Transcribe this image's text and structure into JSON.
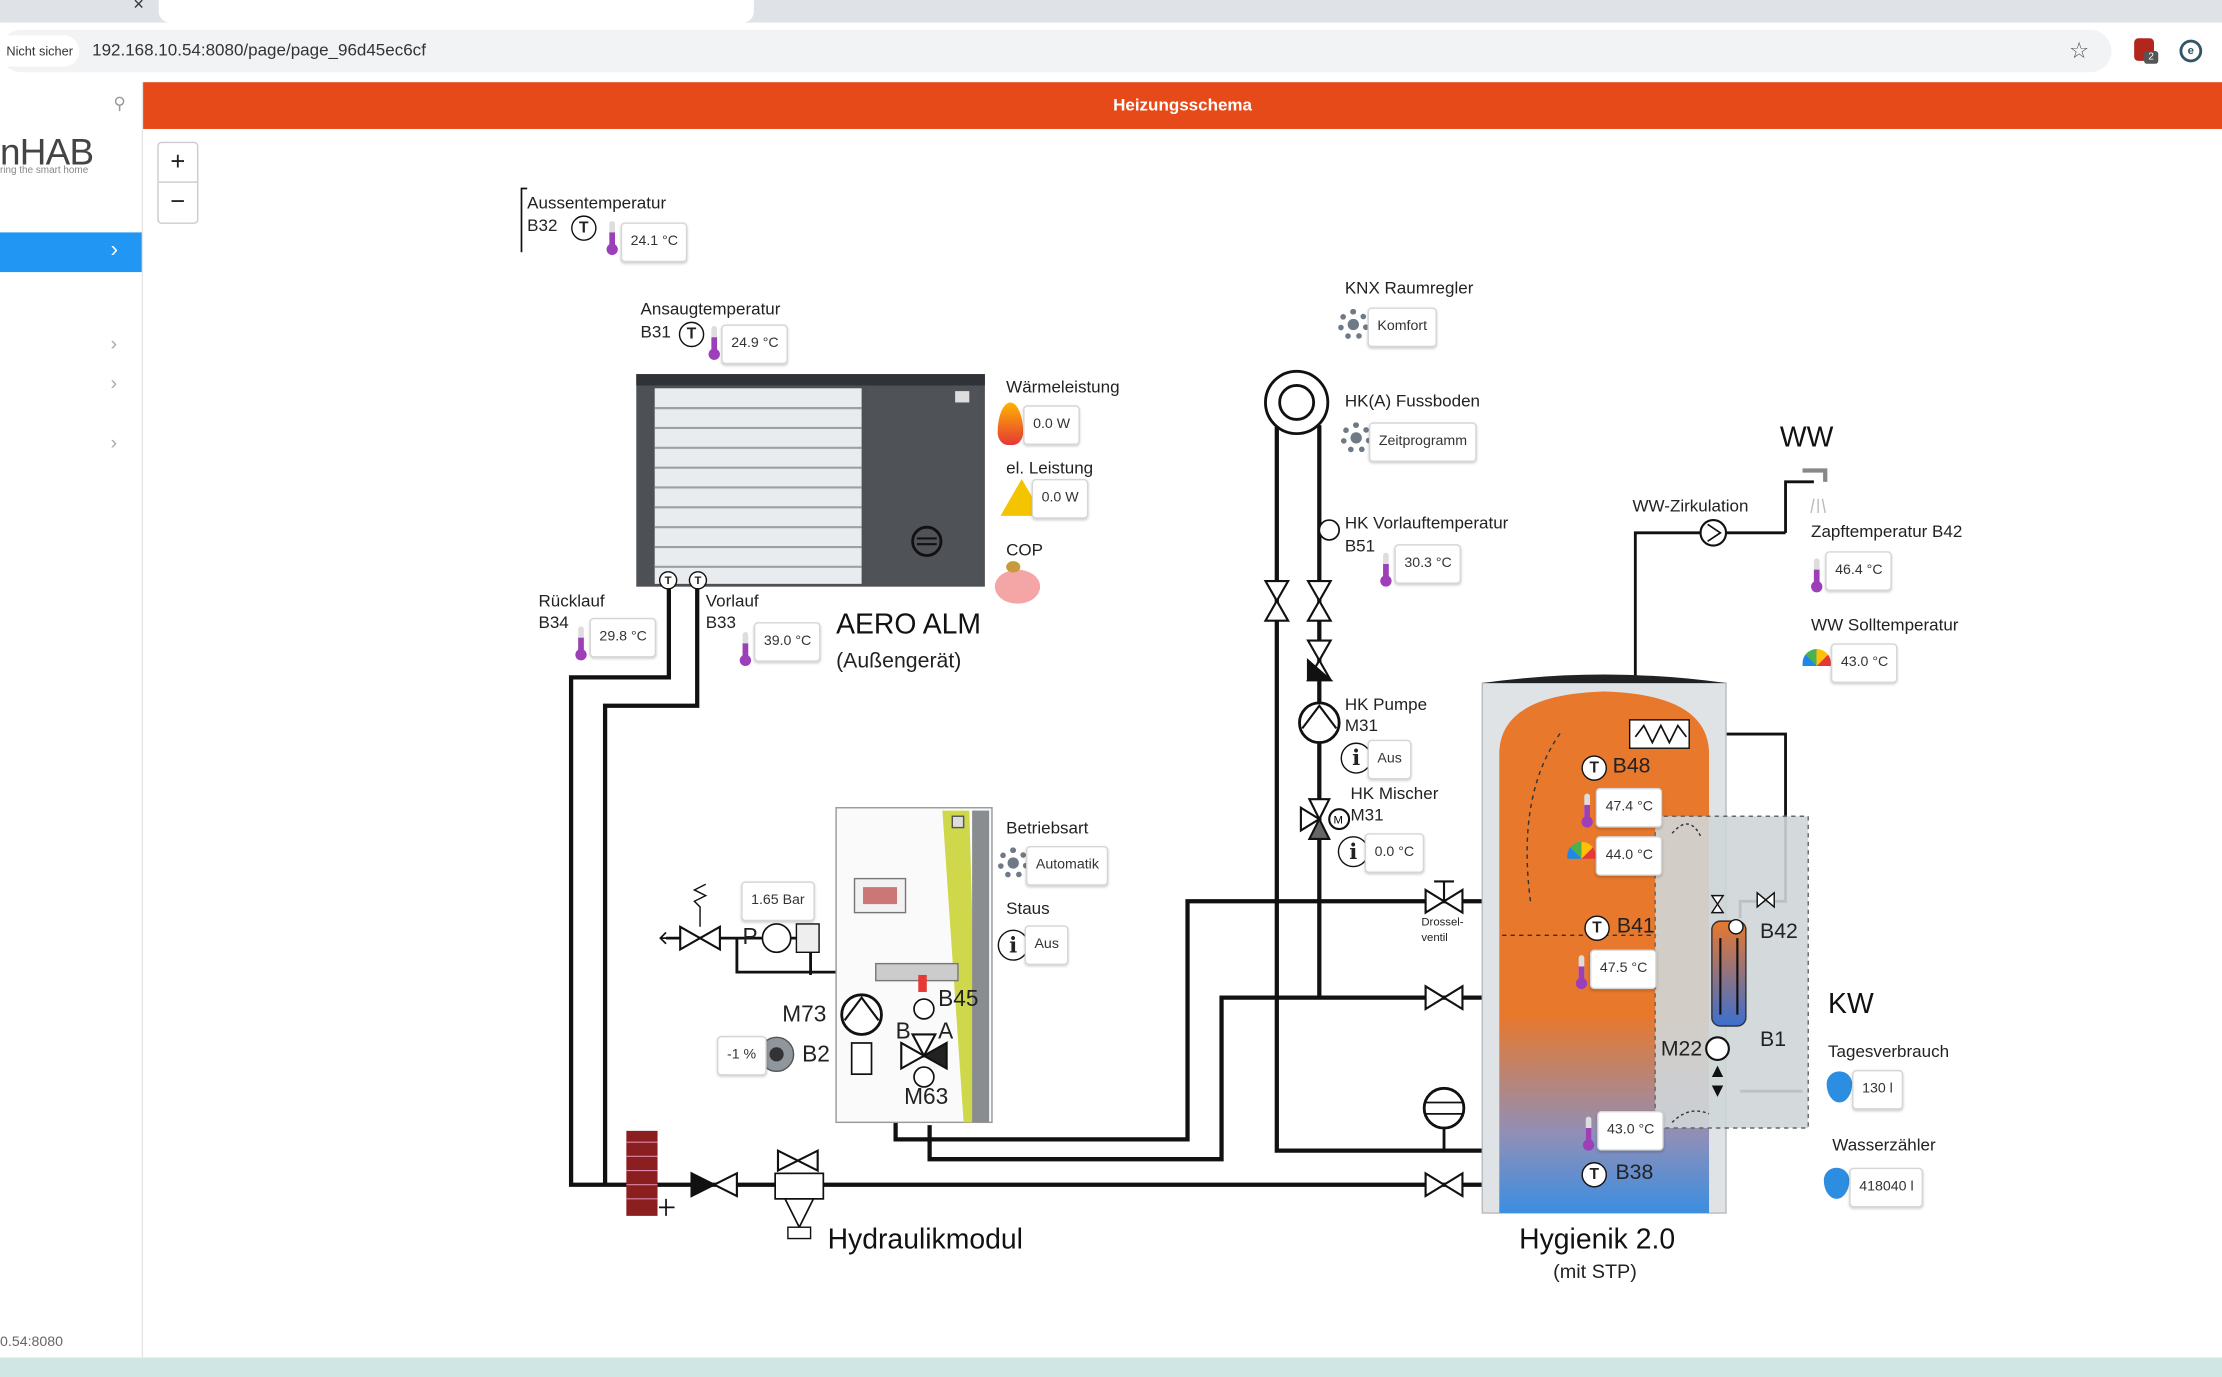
{
  "browser": {
    "security": "Nicht sicher",
    "url": "192.168.10.54:8080/page/page_96d45ec6cf",
    "status_url": "0.54:8080"
  },
  "sidebar": {
    "logo_main": "nHAB",
    "logo_tagline": "ring the smart home"
  },
  "zoom": {
    "plus": "+",
    "minus": "−"
  },
  "header": {
    "title": "Heizungsschema"
  },
  "sensors": {
    "b32": {
      "label": "Aussentemperatur",
      "code": "B32",
      "value": "24.1 °C"
    },
    "b31": {
      "label": "Ansaugtemperatur",
      "code": "B31",
      "value": "24.9 °C"
    },
    "b34": {
      "label": "Rücklauf",
      "code": "B34",
      "value": "29.8 °C"
    },
    "b33": {
      "label": "Vorlauf",
      "code": "B33",
      "value": "39.0 °C"
    },
    "b51": {
      "label": "HK Vorlauftemperatur",
      "code": "B51",
      "value": "30.3 °C"
    },
    "b42": {
      "label": "Zapftemperatur B42",
      "value": "46.4 °C"
    },
    "ww_soll": {
      "label": "WW Solltemperatur",
      "value": "43.0 °C"
    },
    "b48": {
      "code": "B48",
      "value": "47.4 °C",
      "setpoint": "44.0 °C"
    },
    "b41": {
      "code": "B41",
      "value": "47.5 °C"
    },
    "b38": {
      "code": "B38",
      "value": "43.0 °C"
    }
  },
  "heatpump": {
    "name": "AERO ALM",
    "sub": "(Außengerät)",
    "waerme_label": "Wärmeleistung",
    "waerme_value": "0.0 W",
    "el_label": "el. Leistung",
    "el_value": "0.0 W",
    "cop_label": "COP"
  },
  "room": {
    "knx_label": "KNX Raumregler",
    "knx_value": "Komfort",
    "hk_label": "HK(A) Fussboden",
    "hk_value": "Zeitprogramm"
  },
  "hk": {
    "pumpe_label": "HK Pumpe",
    "pumpe_code": "M31",
    "pumpe_value": "Aus",
    "mischer_label": "HK Mischer",
    "mischer_code": "M31",
    "mischer_value": "0.0 °C",
    "drossel": "Drossel-\nventil"
  },
  "hydraulik": {
    "name": "Hydraulikmodul",
    "betriebsart_label": "Betriebsart",
    "betriebsart_value": "Automatik",
    "staus_label": "Staus",
    "staus_value": "Aus",
    "pressure": "1.65 Bar",
    "p": "P",
    "m73": "M73",
    "b2": "B2",
    "b2_value": "-1 %",
    "b45": "B45",
    "m63": "M63",
    "valve_b": "B",
    "valve_a": "A"
  },
  "storage": {
    "name": "Hygienik 2.0",
    "sub": "(mit STP)",
    "ww": "WW",
    "ww_zirk": "WW-Zirkulation",
    "kw": "KW",
    "b42": "B42",
    "b1": "B1",
    "m22": "M22",
    "tages_label": "Tagesverbrauch",
    "tages_value": "130 l",
    "zaehler_label": "Wasserzähler",
    "zaehler_value": "418040 l"
  },
  "colors": {
    "header": "#e64a19",
    "active_nav": "#2196f3",
    "tank_top": "#ea7a2f",
    "tank_bottom": "#4a90d6",
    "thermo": "#9c3fb8",
    "water": "#2d8de0"
  }
}
